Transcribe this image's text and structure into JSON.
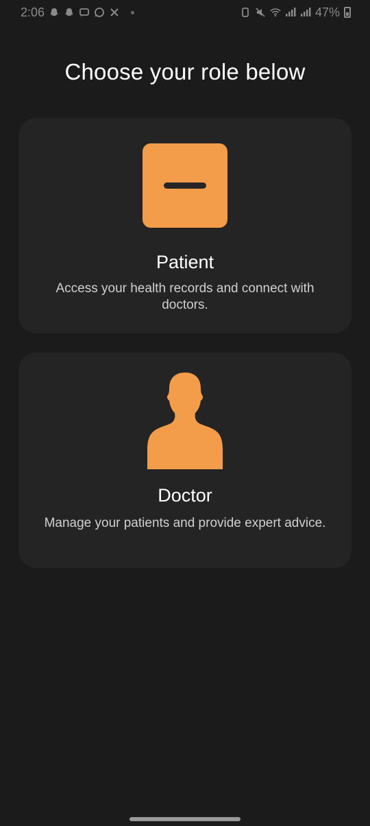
{
  "status_bar": {
    "time": "2:06",
    "battery_percent": "47%",
    "icons_left": [
      "snapchat-icon",
      "snapchat-icon",
      "message-icon",
      "whatsapp-icon",
      "tools-icon",
      "dot-icon"
    ],
    "icons_right": [
      "alarm-icon",
      "mute-icon",
      "wifi-icon",
      "signal-icon",
      "signal-icon",
      "battery-icon"
    ]
  },
  "page": {
    "title": "Choose your role below"
  },
  "roles": [
    {
      "title": "Patient",
      "description": "Access your health records and connect with doctors.",
      "icon": "patient-square-icon"
    },
    {
      "title": "Doctor",
      "description": "Manage your patients and provide expert advice.",
      "icon": "person-silhouette-icon"
    }
  ],
  "colors": {
    "background": "#1b1b1b",
    "card": "#242424",
    "accent": "#f39c4a"
  }
}
